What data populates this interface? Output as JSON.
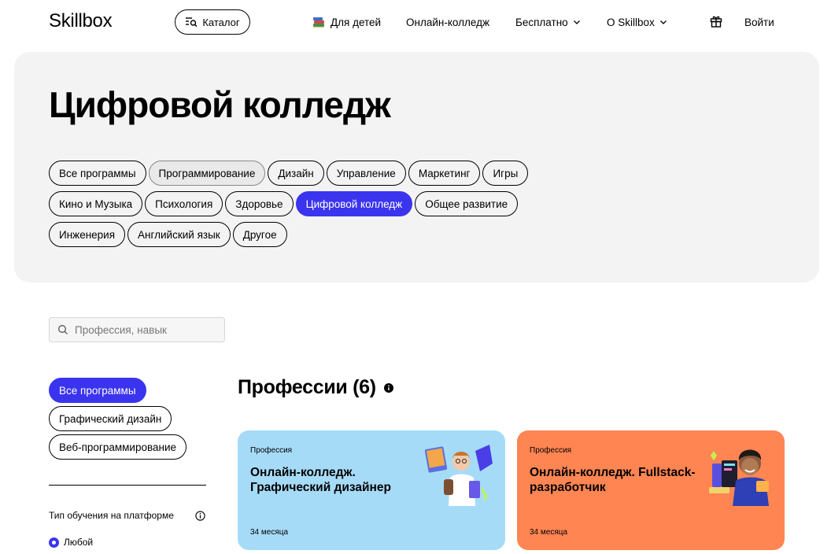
{
  "header": {
    "logo": "Skillbox",
    "catalog_label": "Каталог",
    "nav": {
      "kids": "Для детей",
      "college": "Онлайн-колледж",
      "free": "Бесплатно",
      "about": "О Skillbox"
    },
    "login": "Войти"
  },
  "hero": {
    "title": "Цифровой колледж",
    "categories": [
      {
        "label": "Все программы",
        "state": "default"
      },
      {
        "label": "Программирование",
        "state": "hover"
      },
      {
        "label": "Дизайн",
        "state": "default"
      },
      {
        "label": "Управление",
        "state": "default"
      },
      {
        "label": "Маркетинг",
        "state": "default"
      },
      {
        "label": "Игры",
        "state": "default"
      },
      {
        "label": "Кино и Музыка",
        "state": "default"
      },
      {
        "label": "Психология",
        "state": "default"
      },
      {
        "label": "Здоровье",
        "state": "default"
      },
      {
        "label": "Цифровой колледж",
        "state": "active"
      },
      {
        "label": "Общее развитие",
        "state": "default"
      },
      {
        "label": "Инженерия",
        "state": "default"
      },
      {
        "label": "Английский язык",
        "state": "default"
      },
      {
        "label": "Другое",
        "state": "default"
      }
    ]
  },
  "search": {
    "placeholder": "Профессия, навык"
  },
  "sidebar": {
    "directions": [
      {
        "label": "Все программы",
        "active": true
      },
      {
        "label": "Графический дизайн",
        "active": false
      },
      {
        "label": "Веб-программирование",
        "active": false
      }
    ],
    "filter_title": "Тип обучения на платформе",
    "radio_selected": "Любой"
  },
  "professions": {
    "title": "Профессии (6)",
    "cards": [
      {
        "label": "Профессия",
        "title": "Онлайн-колледж. Графический дизайнер",
        "duration": "34 месяца",
        "color": "#a6dbf8"
      },
      {
        "label": "Профессия",
        "title": "Онлайн-колледж. Fullstack-разработчик",
        "duration": "34 месяца",
        "color": "#ff8552"
      }
    ]
  },
  "colors": {
    "accent": "#3b34ef",
    "hero_bg": "#f3f3f3"
  }
}
